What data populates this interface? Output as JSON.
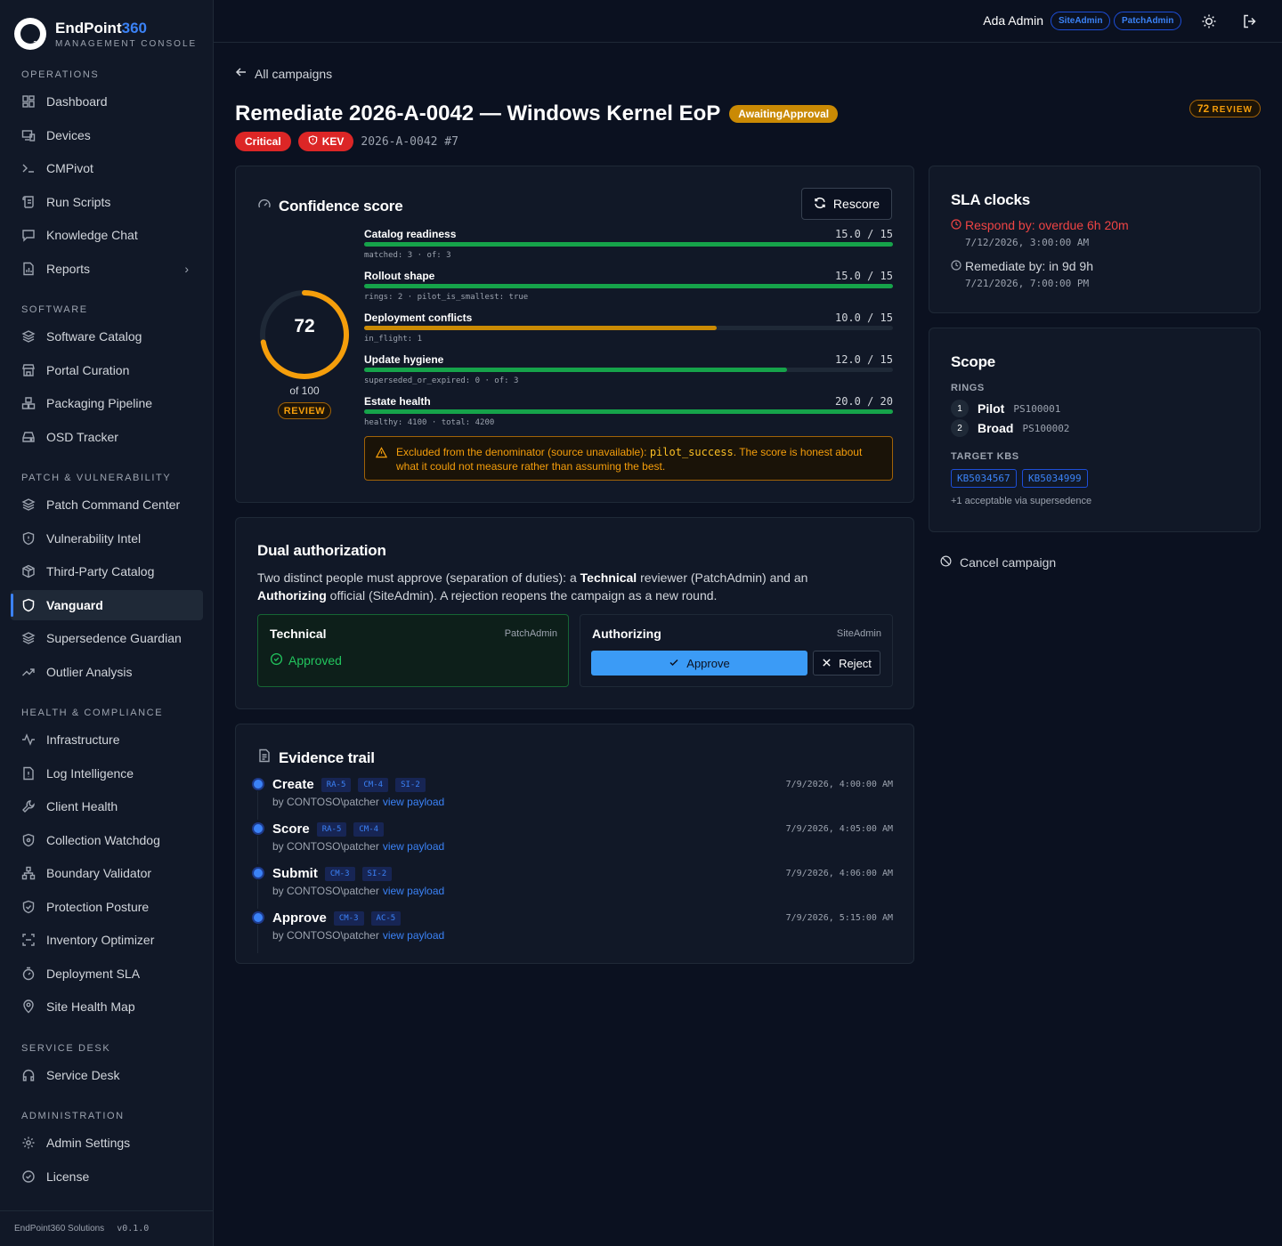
{
  "brand": {
    "name_main": "EndPoint",
    "name_accent": "360",
    "subtitle": "MANAGEMENT CONSOLE",
    "logo_badge": "360"
  },
  "sidebar": {
    "sections": [
      {
        "title": "OPERATIONS"
      },
      {
        "title": "SOFTWARE"
      },
      {
        "title": "PATCH & VULNERABILITY"
      },
      {
        "title": "HEALTH & COMPLIANCE"
      },
      {
        "title": "SERVICE DESK"
      },
      {
        "title": "ADMINISTRATION"
      }
    ],
    "items": [
      {
        "label": "Dashboard",
        "icon": "grid-icon"
      },
      {
        "label": "Devices",
        "icon": "devices-icon"
      },
      {
        "label": "CMPivot",
        "icon": "terminal-icon"
      },
      {
        "label": "Run Scripts",
        "icon": "scroll-icon"
      },
      {
        "label": "Knowledge Chat",
        "icon": "chat-icon"
      },
      {
        "label": "Reports",
        "icon": "file-chart-icon"
      },
      {
        "label": "Software Catalog",
        "icon": "layers-icon"
      },
      {
        "label": "Portal Curation",
        "icon": "store-icon"
      },
      {
        "label": "Packaging Pipeline",
        "icon": "boxes-icon"
      },
      {
        "label": "OSD Tracker",
        "icon": "drive-icon"
      },
      {
        "label": "Patch Command Center",
        "icon": "layers-icon"
      },
      {
        "label": "Vulnerability Intel",
        "icon": "shield-icon"
      },
      {
        "label": "Third-Party Catalog",
        "icon": "package-icon"
      },
      {
        "label": "Vanguard",
        "icon": "shield-icon"
      },
      {
        "label": "Supersedence Guardian",
        "icon": "layers-icon"
      },
      {
        "label": "Outlier Analysis",
        "icon": "trend-icon"
      },
      {
        "label": "Infrastructure",
        "icon": "activity-icon"
      },
      {
        "label": "Log Intelligence",
        "icon": "file-alert-icon"
      },
      {
        "label": "Client Health",
        "icon": "wrench-icon"
      },
      {
        "label": "Collection Watchdog",
        "icon": "shield-icon"
      },
      {
        "label": "Boundary Validator",
        "icon": "network-icon"
      },
      {
        "label": "Protection Posture",
        "icon": "shield-icon"
      },
      {
        "label": "Inventory Optimizer",
        "icon": "scan-icon"
      },
      {
        "label": "Deployment SLA",
        "icon": "timer-icon"
      },
      {
        "label": "Site Health Map",
        "icon": "pin-icon"
      },
      {
        "label": "Service Desk",
        "icon": "headset-icon"
      },
      {
        "label": "Admin Settings",
        "icon": "gear-icon"
      },
      {
        "label": "License",
        "icon": "check-circle-icon"
      }
    ],
    "footer_company": "EndPoint360 Solutions",
    "footer_version": "v0.1.0"
  },
  "topbar": {
    "user": "Ada Admin",
    "roles": [
      "SiteAdmin",
      "PatchAdmin"
    ]
  },
  "page": {
    "back_label": "All campaigns",
    "title": "Remediate 2026-A-0042 — Windows Kernel EoP",
    "status": "AwaitingApproval",
    "score_chip_value": "72",
    "score_chip_band": "REVIEW",
    "severity": "Critical",
    "kev": "KEV",
    "id_round": "2026-A-0042 #7"
  },
  "confidence": {
    "title": "Confidence score",
    "rescore_label": "Rescore",
    "score": 72,
    "score_text": "72",
    "of_label": "of 100",
    "band": "REVIEW",
    "accent_color": "#f59e0b",
    "metrics": [
      {
        "name": "Catalog readiness",
        "value": "15.0 / 15",
        "fraction": 1.0,
        "color": "#16a34a",
        "detail": "matched: 3 · of: 3"
      },
      {
        "name": "Rollout shape",
        "value": "15.0 / 15",
        "fraction": 1.0,
        "color": "#16a34a",
        "detail": "rings: 2 · pilot_is_smallest: true"
      },
      {
        "name": "Deployment conflicts",
        "value": "10.0 / 15",
        "fraction": 0.6667,
        "color": "#ca8a04",
        "detail": "in_flight: 1"
      },
      {
        "name": "Update hygiene",
        "value": "12.0 / 15",
        "fraction": 0.8,
        "color": "#16a34a",
        "detail": "superseded_or_expired: 0 · of: 3"
      },
      {
        "name": "Estate health",
        "value": "20.0 / 20",
        "fraction": 1.0,
        "color": "#16a34a",
        "detail": "healthy: 4100 · total: 4200"
      }
    ],
    "warning_pre": "Excluded from the denominator (source unavailable): ",
    "warning_code": "pilot_success",
    "warning_post": ". The score is honest about what it could not measure rather than assuming the best."
  },
  "dual": {
    "title": "Dual authorization",
    "desc_1": "Two distinct people must approve (separation of duties): a ",
    "desc_b1": "Technical",
    "desc_2": " reviewer (PatchAdmin) and an ",
    "desc_b2": "Authorizing",
    "desc_3": " official (SiteAdmin). A rejection reopens the campaign as a new round.",
    "technical": {
      "name": "Technical",
      "role": "PatchAdmin",
      "status": "Approved"
    },
    "authorizing": {
      "name": "Authorizing",
      "role": "SiteAdmin",
      "approve_label": "Approve",
      "reject_label": "Reject"
    }
  },
  "evidence": {
    "title": "Evidence trail",
    "link_label": "view payload",
    "events": [
      {
        "action": "Create",
        "controls": [
          "RA-5",
          "CM-4",
          "SI-2"
        ],
        "by": "by CONTOSO\\patcher",
        "ts": "7/9/2026, 4:00:00 AM"
      },
      {
        "action": "Score",
        "controls": [
          "RA-5",
          "CM-4"
        ],
        "by": "by CONTOSO\\patcher",
        "ts": "7/9/2026, 4:05:00 AM"
      },
      {
        "action": "Submit",
        "controls": [
          "CM-3",
          "SI-2"
        ],
        "by": "by CONTOSO\\patcher",
        "ts": "7/9/2026, 4:06:00 AM"
      },
      {
        "action": "Approve",
        "controls": [
          "CM-3",
          "AC-5"
        ],
        "by": "by CONTOSO\\patcher",
        "ts": "7/9/2026, 5:15:00 AM"
      }
    ]
  },
  "sla": {
    "title": "SLA clocks",
    "respond_label": "Respond by: overdue 6h 20m",
    "respond_ts": "7/12/2026, 3:00:00 AM",
    "remediate_label": "Remediate by: in 9d 9h",
    "remediate_ts": "7/21/2026, 7:00:00 PM",
    "overdue_color": "#ef4444"
  },
  "scope": {
    "title": "Scope",
    "rings_label": "RINGS",
    "rings": [
      {
        "num": "1",
        "name": "Pilot",
        "id": "PS100001"
      },
      {
        "num": "2",
        "name": "Broad",
        "id": "PS100002"
      }
    ],
    "kbs_label": "TARGET KBS",
    "kbs": [
      "KB5034567",
      "KB5034999"
    ],
    "kb_note": "+1 acceptable via supersedence"
  },
  "cancel_label": "Cancel campaign"
}
